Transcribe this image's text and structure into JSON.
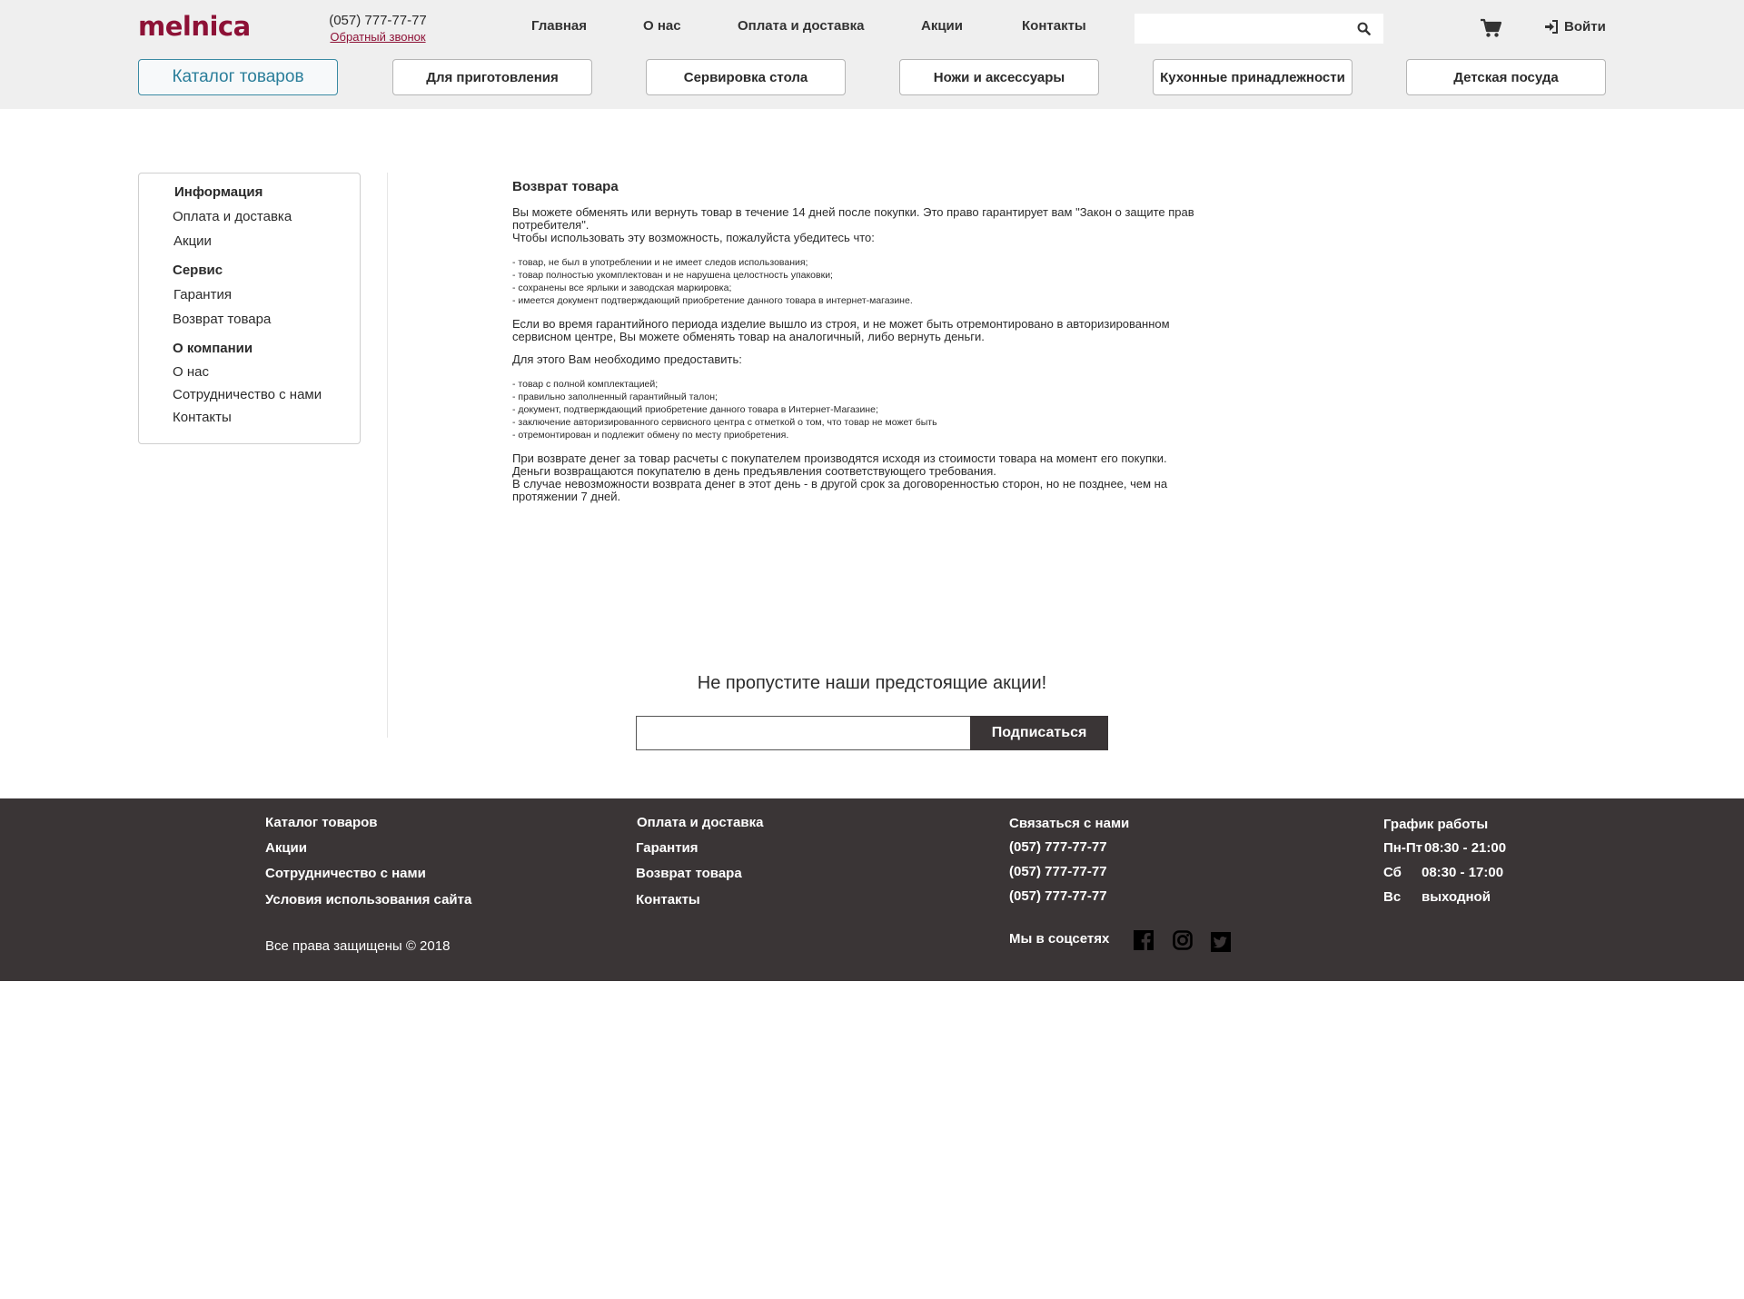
{
  "header": {
    "logo": "melnica",
    "phone": "(057) 777-77-77",
    "callback": "Обратный звонок",
    "nav": [
      "Главная",
      "О нас",
      "Оплата и доставка",
      "Акции",
      "Контакты"
    ],
    "search": {
      "value": "",
      "placeholder": ""
    },
    "login": "Войти",
    "categories": [
      "Каталог товаров",
      "Для приготовления",
      "Сервировка стола",
      "Ножи и аксессуары",
      "Кухонные принадлежности",
      "Детская посуда"
    ]
  },
  "sidebar": {
    "sections": [
      {
        "title": "Информация",
        "items": [
          "Оплата и доставка",
          "Акции"
        ]
      },
      {
        "title": "Сервис",
        "items": [
          "Гарантия",
          "Возврат товара"
        ]
      },
      {
        "title": "О компании",
        "items": [
          "О нас",
          "Сотрудничество с нами",
          "Контакты"
        ]
      }
    ]
  },
  "content": {
    "title": "Возврат товара",
    "p1": "Вы можете обменять или вернуть товар в течение 14 дней после покупки. Это право гарантирует вам \"Закон о защите прав потребителя\".",
    "p2": "Чтобы использовать эту возможность, пожалуйста убедитесь что:",
    "list1": [
      "- товар, не был в употреблении и не имеет следов использования;",
      "- товар полностью укомплектован и не нарушена целостность упаковки;",
      "- сохранены все ярлыки и заводская маркировка;",
      "- имеется документ подтверждающий приобретение данного товара в интернет-магазине."
    ],
    "p3": "Если во время гарантийного периода изделие вышло из строя, и не может быть отремонтировано в авторизированном сервисном центре, Вы можете обменять товар на аналогичный, либо вернуть деньги.",
    "p4": "Для этого Вам необходимо предоставить:",
    "list2": [
      "- товар с полной комплектацией;",
      "- правильно заполненный гарантийный талон;",
      "- документ, подтверждающий приобретение данного товара в Интернет-Магазине;",
      "- заключение авторизированного сервисного центра с отметкой о том, что товар не может быть",
      "- отремонтирован и подлежит обмену по месту приобретения."
    ],
    "p5": "При возврате денег за товар расчеты с покупателем производятся исходя из стоимости товара на момент его покупки.",
    "p6": "Деньги возвращаются покупателю в день предъявления соответствующего требования.",
    "p7": "В случае невозможности возврата денег в этот день - в другой срок за договоренностью сторон, но не позднее, чем на протяжении 7 дней."
  },
  "subscribe": {
    "title": "Не пропустите наши предстоящие акции!",
    "input_value": "",
    "button": "Подписаться"
  },
  "footer": {
    "col1": [
      "Каталог товаров",
      "Акции",
      "Сотрудничество с нами",
      "Условия использования сайта"
    ],
    "col2": [
      "Оплата и доставка",
      "Гарантия",
      "Возврат товара",
      "Контакты"
    ],
    "contacts_title": "Связаться с нами",
    "phones": [
      "(057) 777-77-77",
      "(057) 777-77-77",
      "(057) 777-77-77"
    ],
    "social_label": "Мы в соцсетях",
    "social_icons": [
      "facebook-icon",
      "instagram-icon",
      "twitter-icon"
    ],
    "schedule_title": "График работы",
    "schedule": [
      {
        "day": "Пн-Пт",
        "time": "08:30 - 21:00"
      },
      {
        "day": "Сб",
        "time": "08:30 - 17:00"
      },
      {
        "day": "Вс",
        "time": "выходной"
      }
    ],
    "copyright": "Все права защищены © 2018"
  },
  "colors": {
    "brand": "#8d1136",
    "accent": "#2a7e9a",
    "footer_bg": "#3a3536",
    "header_bg": "#efefef"
  }
}
